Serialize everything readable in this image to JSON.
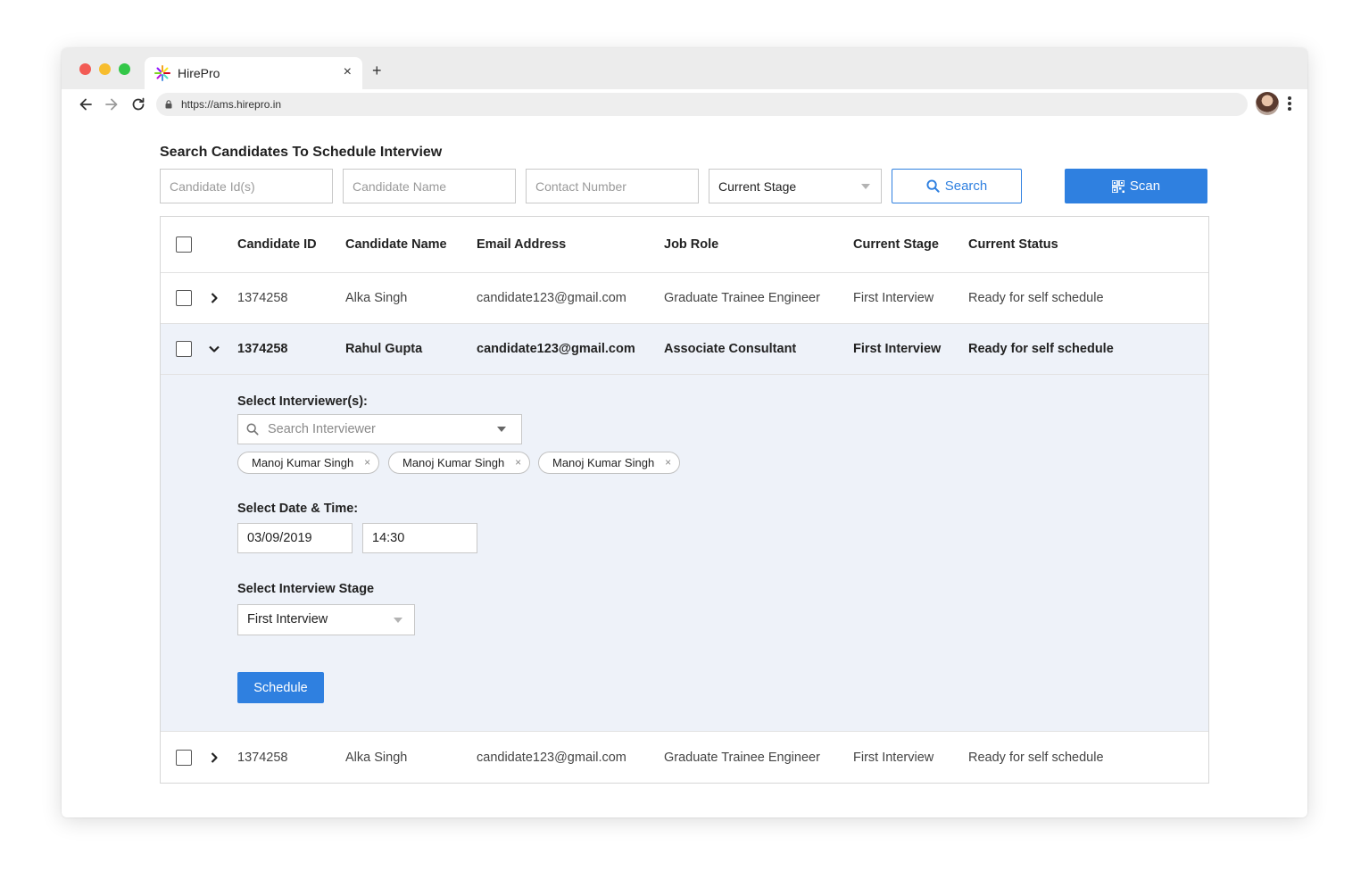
{
  "browser": {
    "tab_title": "HirePro",
    "tab_close": "×",
    "new_tab": "+",
    "url": "https://ams.hirepro.in"
  },
  "page": {
    "title": "Search Candidates To Schedule Interview"
  },
  "filters": {
    "candidate_id_placeholder": "Candidate Id(s)",
    "candidate_name_placeholder": "Candidate Name",
    "contact_number_placeholder": "Contact Number",
    "current_stage_value": "Current Stage",
    "search_label": "Search",
    "scan_label": "Scan"
  },
  "table": {
    "headers": [
      "Candidate ID",
      "Candidate Name",
      "Email Address",
      "Job Role",
      "Current Stage",
      "Current Status"
    ],
    "rows": [
      {
        "id": "1374258",
        "name": "Alka Singh",
        "email": "candidate123@gmail.com",
        "role": "Graduate Trainee Engineer",
        "stage": "First Interview",
        "status": "Ready for self schedule"
      },
      {
        "id": "1374258",
        "name": "Rahul Gupta",
        "email": "candidate123@gmail.com",
        "role": "Associate Consultant",
        "stage": "First Interview",
        "status": "Ready for self schedule"
      },
      {
        "id": "1374258",
        "name": "Alka Singh",
        "email": "candidate123@gmail.com",
        "role": "Graduate Trainee Engineer",
        "stage": "First Interview",
        "status": "Ready for self schedule"
      }
    ]
  },
  "expanded": {
    "interviewer_label": "Select Interviewer(s):",
    "interviewer_placeholder": "Search Interviewer",
    "chips": [
      "Manoj Kumar Singh",
      "Manoj Kumar Singh",
      "Manoj Kumar Singh"
    ],
    "chip_remove": "×",
    "datetime_label": "Select Date & Time:",
    "date_value": "03/09/2019",
    "time_value": "14:30",
    "stage_label": "Select Interview Stage",
    "stage_value": "First Interview",
    "schedule_label": "Schedule"
  },
  "colors": {
    "accent": "#2f80e0",
    "expanded_bg": "#eef2f9"
  }
}
